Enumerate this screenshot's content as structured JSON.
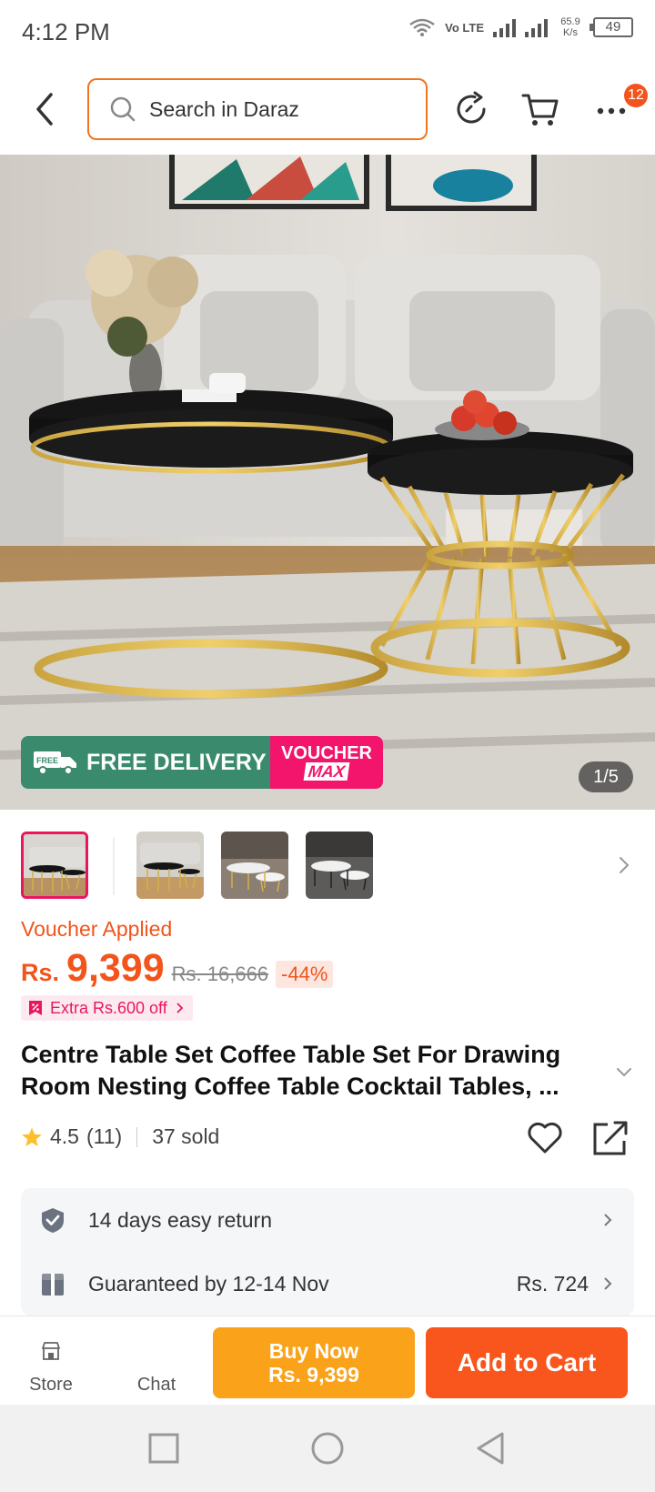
{
  "status_bar": {
    "time": "4:12 PM",
    "network": "Vo LTE",
    "speed": "65.9 K/s",
    "battery": "49"
  },
  "header": {
    "search_placeholder": "Search in Daraz",
    "cart_badge": "12"
  },
  "hero": {
    "promo_free_delivery": "FREE DELIVERY",
    "promo_voucher_1": "VOUCHER",
    "promo_voucher_2": "MAX",
    "counter": "1/5"
  },
  "price": {
    "voucher_applied": "Voucher Applied",
    "currency": "Rs.",
    "amount": "9,399",
    "original": "Rs. 16,666",
    "discount": "-44%",
    "extra_off": "Extra Rs.600 off"
  },
  "product": {
    "title": "Centre Table Set Coffee Table Set For Drawing Room Nesting Coffee Table Cocktail Tables, ...",
    "rating": "4.5",
    "review_count": "(11)",
    "sold": "37 sold"
  },
  "info": {
    "return_text": "14 days easy return",
    "delivery_text": "Guaranteed by 12-14 Nov",
    "delivery_price": "Rs. 724"
  },
  "bottom_bar": {
    "store_label": "Store",
    "chat_label": "Chat",
    "buy_now_label": "Buy Now",
    "buy_now_price": "Rs. 9,399",
    "add_to_cart_label": "Add to Cart"
  },
  "colors": {
    "accent": "#f2541b",
    "buy_now": "#faa21a",
    "add_to_cart": "#f8561d",
    "promo_green": "#3a8a6d",
    "promo_pink": "#f2156b"
  }
}
